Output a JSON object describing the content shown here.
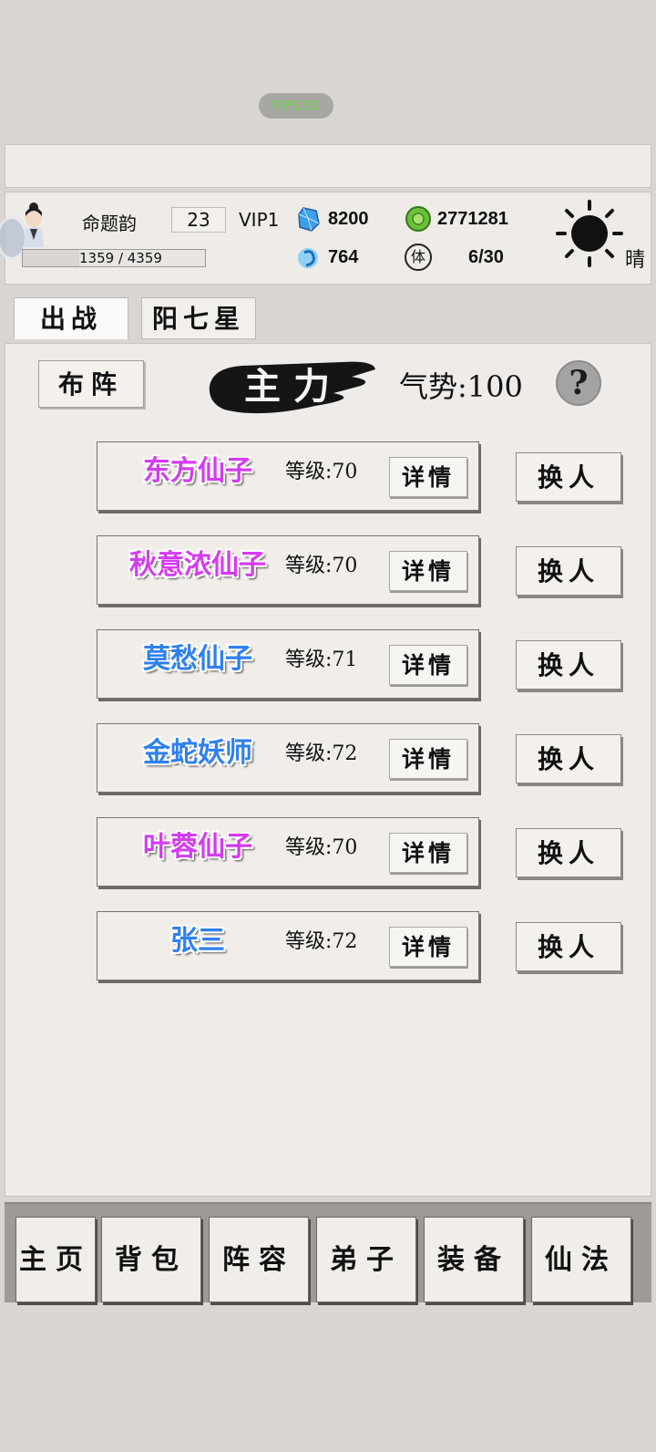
{
  "fps_badge": "FPS30",
  "player": {
    "name": "命题韵",
    "level": "23",
    "vip": "VIP1",
    "exp_text": "1359 / 4359",
    "exp_fraction": 0.31
  },
  "resources": {
    "gems": "8200",
    "coins": "2771281",
    "spirit": "764",
    "stamina": "6/30",
    "stamina_icon_char": "体"
  },
  "weather": {
    "label": "晴",
    "icon": "sun-icon"
  },
  "tabs": [
    {
      "label": "出战",
      "active": true
    },
    {
      "label": "阳七星",
      "active": false
    }
  ],
  "formation": {
    "button_label": "布阵",
    "team_label": "主力",
    "momentum": "气势:100",
    "help_label": "?"
  },
  "heroes": [
    {
      "name": "东方仙子",
      "level": "等级:70",
      "color": "#d43cf0",
      "detail": "详情",
      "swap": "换人"
    },
    {
      "name": "秋意浓仙子",
      "level": "等级:70",
      "color": "#d43cf0",
      "detail": "详情",
      "swap": "换人"
    },
    {
      "name": "莫愁仙子",
      "level": "等级:71",
      "color": "#2f80ee",
      "detail": "详情",
      "swap": "换人"
    },
    {
      "name": "金蛇妖师",
      "level": "等级:72",
      "color": "#2f80ee",
      "detail": "详情",
      "swap": "换人"
    },
    {
      "name": "叶蓉仙子",
      "level": "等级:70",
      "color": "#d43cf0",
      "detail": "详情",
      "swap": "换人"
    },
    {
      "name": "张三",
      "level": "等级:72",
      "color": "#2f80ee",
      "detail": "详情",
      "swap": "换人"
    }
  ],
  "nav": [
    "主页",
    "背包",
    "阵容",
    "弟子",
    "装备",
    "仙法"
  ]
}
